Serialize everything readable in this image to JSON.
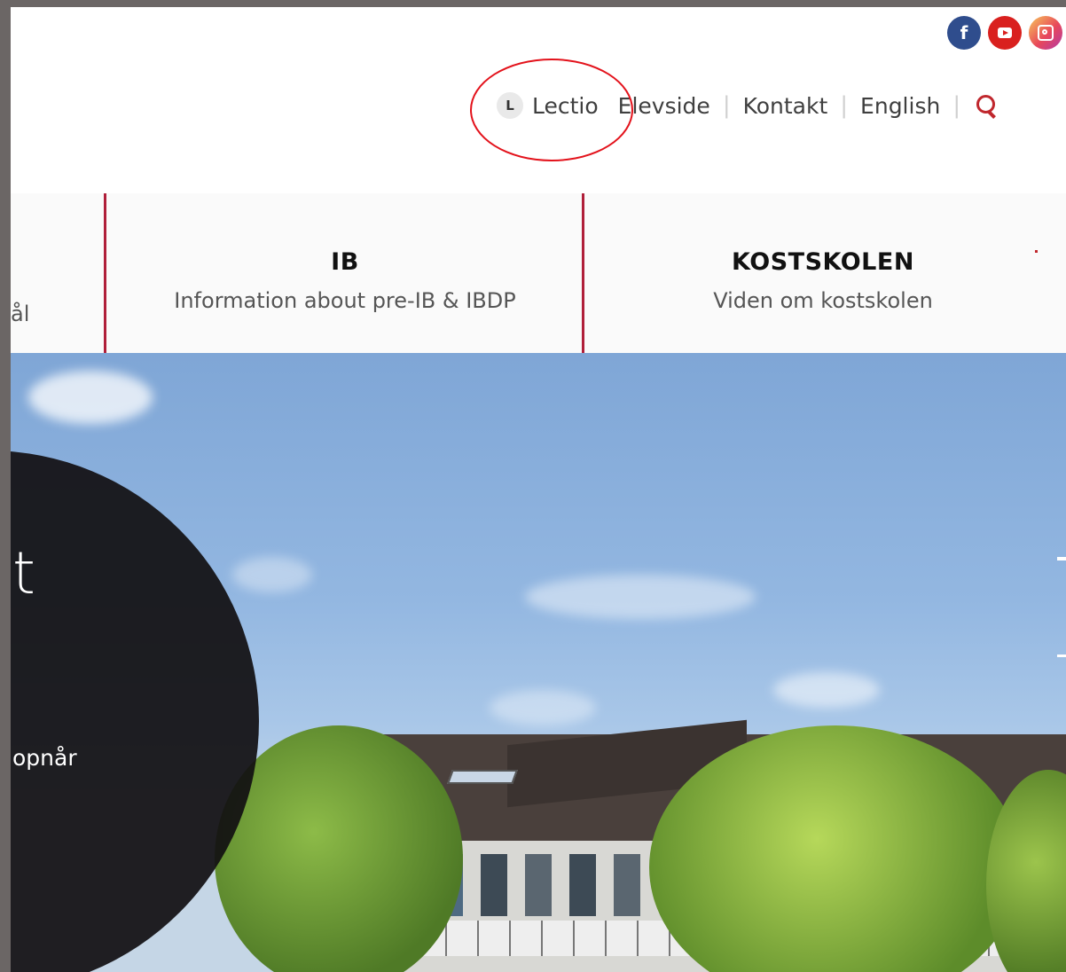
{
  "social": {
    "facebook_icon": "facebook-icon",
    "youtube_icon": "youtube-icon",
    "instagram_icon": "instagram-icon",
    "facebook_glyph": "f"
  },
  "toplinks": {
    "lectio_badge": "L",
    "lectio": "Lectio",
    "elevside": "Elevside",
    "kontakt": "Kontakt",
    "english": "English",
    "separator": "|"
  },
  "nav": {
    "cut_text": "ål",
    "ib_title": "IB",
    "ib_sub": "Information about pre-IB & IBDP",
    "kost_title": "KOSTSKOLEN",
    "kost_sub": "Viden om kostskolen"
  },
  "hero": {
    "big_text": "t",
    "small_text": "opnår"
  },
  "colors": {
    "accent": "#b01f3a",
    "annotation": "#e3121b",
    "search": "#c0272d"
  }
}
